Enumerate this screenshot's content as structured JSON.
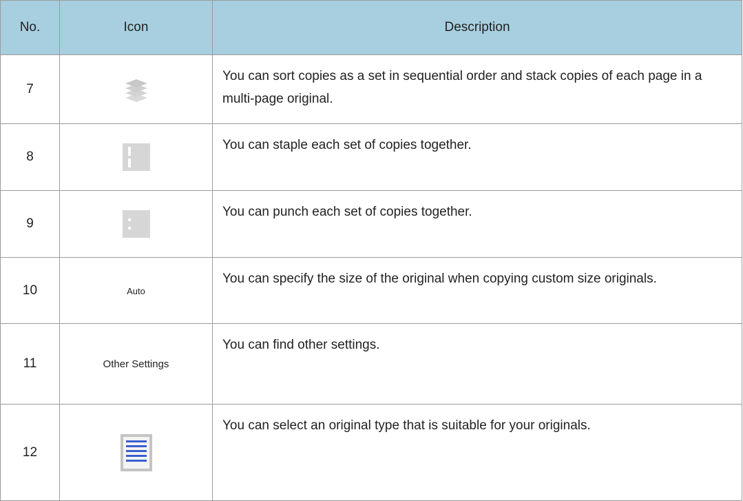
{
  "table": {
    "headers": {
      "no": "No.",
      "icon": "Icon",
      "description": "Description"
    },
    "rows": [
      {
        "no": "7",
        "icon_name": "sort-stack-icon",
        "icon_text": "",
        "description": "You can sort copies as a set in sequential order and stack copies of each page in a multi-page original."
      },
      {
        "no": "8",
        "icon_name": "staple-icon",
        "icon_text": "",
        "description": "You can staple each set of copies together."
      },
      {
        "no": "9",
        "icon_name": "punch-icon",
        "icon_text": "",
        "description": "You can punch each set of copies together."
      },
      {
        "no": "10",
        "icon_name": "auto-text-icon",
        "icon_text": "Auto",
        "description": "You can specify the size of the original when copying custom size originals."
      },
      {
        "no": "11",
        "icon_name": "other-settings-text-icon",
        "icon_text": "Other Settings",
        "description": "You can find other settings."
      },
      {
        "no": "12",
        "icon_name": "original-type-icon",
        "icon_text": "",
        "description": "You can select an original type that is suitable for your originals."
      }
    ]
  },
  "colors": {
    "header_bg": "#a7cfdf",
    "border": "#9a9a9a",
    "icon_gray": "#d6d6d6",
    "icon_blue": "#3b5fd0"
  }
}
